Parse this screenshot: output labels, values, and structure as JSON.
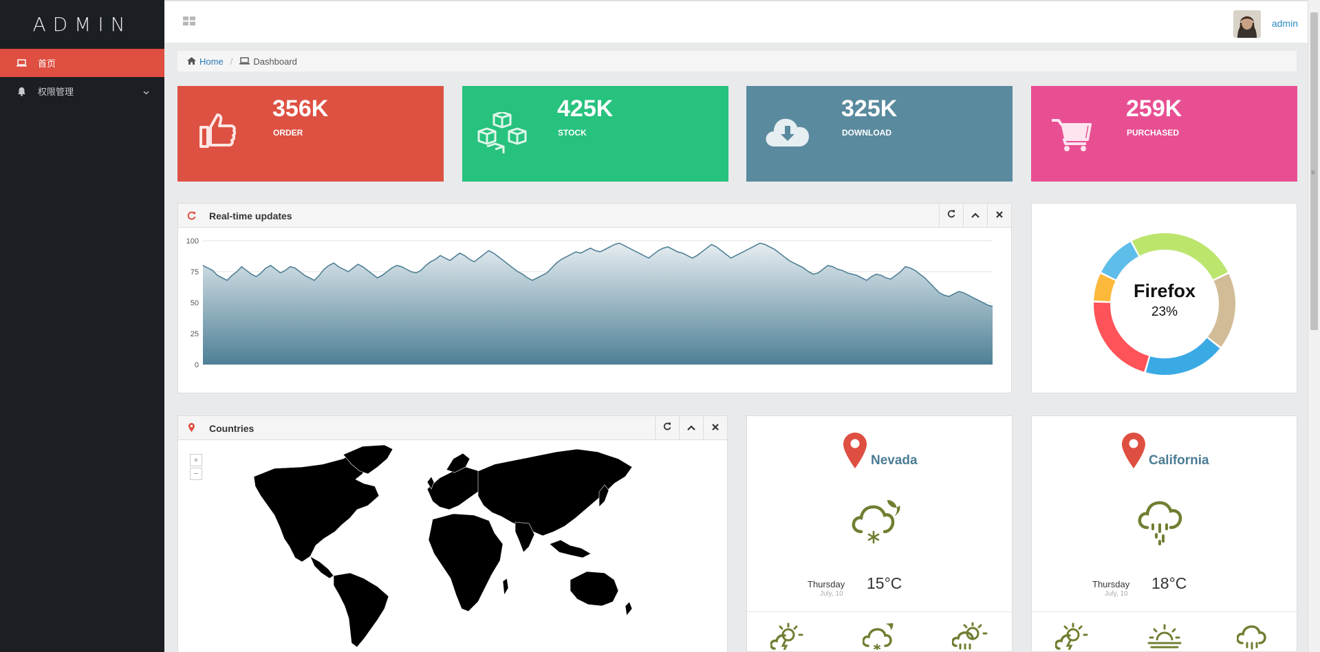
{
  "brand": "ADMIN",
  "sidebar": {
    "items": [
      {
        "label": "首页",
        "icon": "laptop-icon"
      },
      {
        "label": "权限管理",
        "icon": "bell-icon"
      }
    ]
  },
  "topbar": {
    "user": "admin"
  },
  "breadcrumb": {
    "home": "Home",
    "current": "Dashboard"
  },
  "tiles": [
    {
      "value": "356K",
      "label": "ORDER",
      "color": "#dd5143",
      "icon": "thumbs-up-icon"
    },
    {
      "value": "425K",
      "label": "STOCK",
      "color": "#27c27e",
      "icon": "cubes-icon"
    },
    {
      "value": "325K",
      "label": "DOWNLOAD",
      "color": "#5a8a9e",
      "icon": "cloud-download-icon"
    },
    {
      "value": "259K",
      "label": "PURCHASED",
      "color": "#e84f93",
      "icon": "cart-icon"
    }
  ],
  "realtime": {
    "title": "Real-time updates"
  },
  "chart_data": [
    {
      "type": "area",
      "ylim": [
        0,
        100
      ],
      "yticks": [
        "0",
        "25",
        "50",
        "75",
        "100"
      ],
      "y": [
        80,
        78,
        76,
        72,
        70,
        68,
        72,
        75,
        79,
        76,
        73,
        71,
        74,
        78,
        80,
        77,
        74,
        76,
        79,
        78,
        75,
        72,
        70,
        68,
        72,
        77,
        80,
        82,
        79,
        77,
        75,
        78,
        81,
        79,
        76,
        73,
        70,
        72,
        75,
        78,
        80,
        79,
        77,
        75,
        74,
        76,
        80,
        83,
        85,
        88,
        86,
        84,
        87,
        90,
        88,
        85,
        83,
        86,
        89,
        92,
        90,
        87,
        84,
        81,
        78,
        75,
        73,
        70,
        68,
        70,
        72,
        74,
        78,
        82,
        85,
        87,
        89,
        91,
        90,
        92,
        94,
        92,
        91,
        93,
        95,
        97,
        98,
        96,
        94,
        92,
        90,
        88,
        86,
        89,
        92,
        94,
        95,
        93,
        91,
        90,
        88,
        86,
        88,
        91,
        94,
        97,
        95,
        92,
        89,
        86,
        88,
        90,
        92,
        94,
        96,
        98,
        97,
        95,
        93,
        90,
        87,
        84,
        82,
        80,
        78,
        75,
        73,
        74,
        77,
        80,
        79,
        77,
        76,
        74,
        73,
        72,
        70,
        68,
        71,
        73,
        72,
        70,
        69,
        72,
        75,
        79,
        78,
        76,
        73,
        70,
        66,
        62,
        58,
        56,
        55,
        57,
        59,
        58,
        56,
        54,
        52,
        50,
        48,
        47
      ]
    },
    {
      "type": "pie",
      "labels": [
        "Firefox",
        "",
        "",
        "",
        "",
        ""
      ],
      "values": [
        23,
        16,
        17,
        19,
        6,
        9
      ],
      "colors": [
        "#bce56e",
        "#d2bc97",
        "#3aaae5",
        "#fe5358",
        "#fcb83b",
        "#5ebde9"
      ],
      "center_label": "Firefox",
      "center_value": "23%"
    }
  ],
  "countries": {
    "title": "Countries",
    "zoom_in": "+",
    "zoom_out": "−"
  },
  "weather": [
    {
      "city": "Nevada",
      "day": "Thursday",
      "date": "July, 10",
      "temp": "15°C",
      "icon": "cloud-moon-snow-icon"
    },
    {
      "city": "California",
      "day": "Thursday",
      "date": "July, 10",
      "temp": "18°C",
      "icon": "cloud-rain-icon"
    }
  ],
  "colors": {
    "sidebar": "#1b1f23",
    "accent": "#de4f42",
    "weather_icon": "#6f7f32",
    "link": "#2a8bc4"
  }
}
